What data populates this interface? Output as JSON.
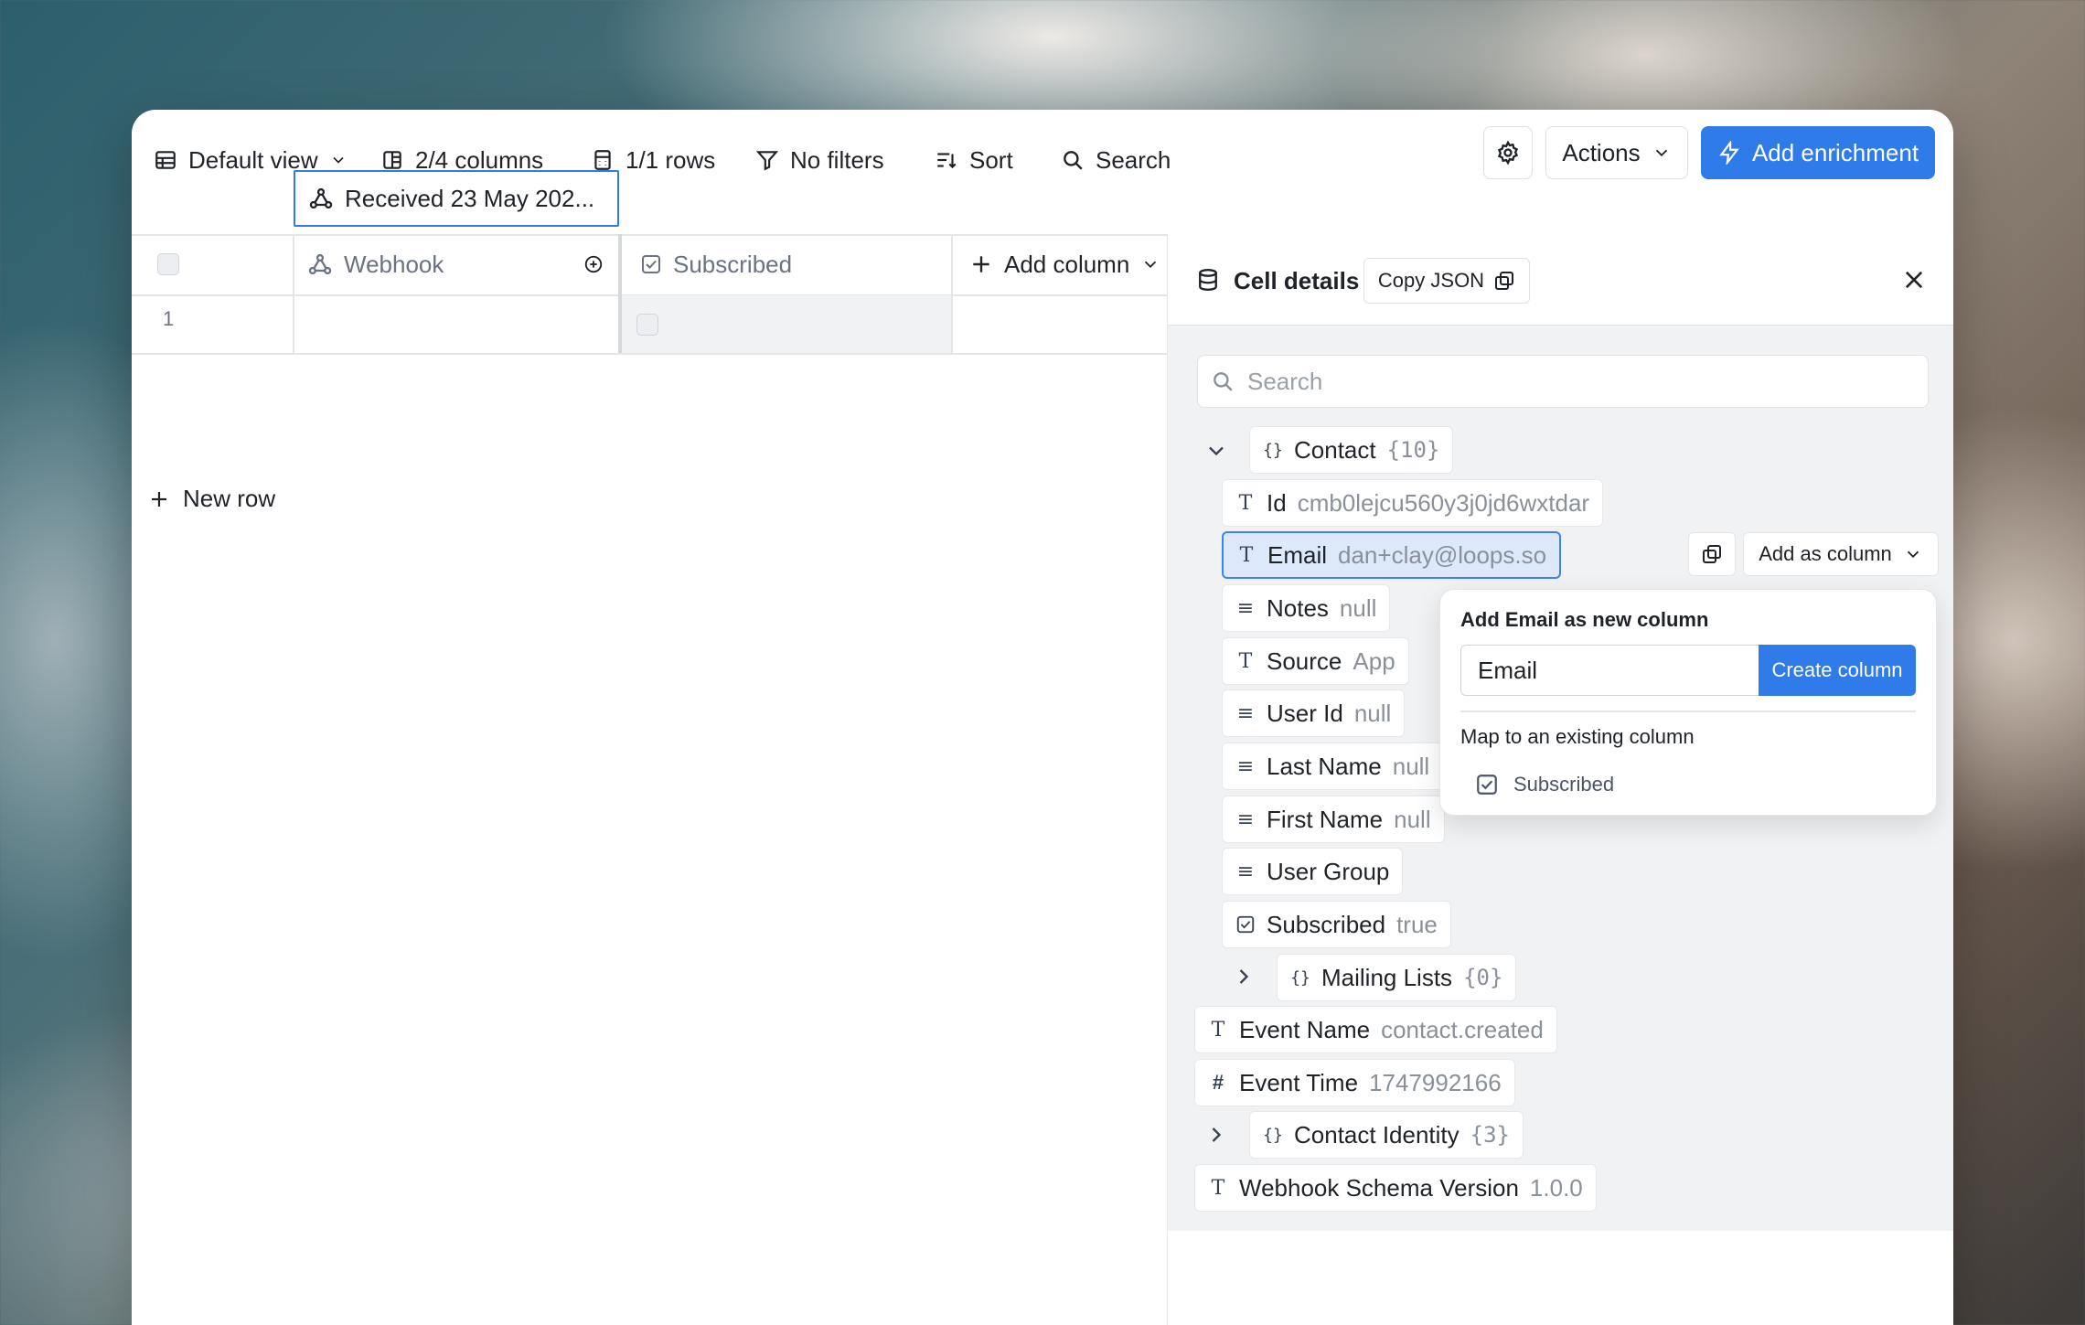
{
  "toolbar": {
    "view": "Default view",
    "columns": "2/4 columns",
    "rows": "1/1 rows",
    "filters": "No filters",
    "sort": "Sort",
    "search": "Search",
    "actions": "Actions",
    "add_enrichment": "Add enrichment"
  },
  "grid": {
    "headers": {
      "webhook": "Webhook",
      "subscribed": "Subscribed",
      "add_column": "Add column"
    },
    "rows": [
      {
        "num": "1",
        "webhook": "Received 23 May 202..."
      }
    ],
    "new_row": "New row"
  },
  "panel": {
    "title": "Cell details",
    "copy_json": "Copy JSON",
    "search_placeholder": "Search",
    "tree": {
      "contact": {
        "key": "Contact",
        "count": "{10}"
      },
      "id": {
        "key": "Id",
        "value": "cmb0lejcu560y3j0jd6wxtdar"
      },
      "email": {
        "key": "Email",
        "value": "dan+clay@loops.so"
      },
      "notes": {
        "key": "Notes",
        "value": "null"
      },
      "source": {
        "key": "Source",
        "value": "App"
      },
      "user_id": {
        "key": "User Id",
        "value": "null"
      },
      "last_name": {
        "key": "Last Name",
        "value": "null"
      },
      "first_name": {
        "key": "First Name",
        "value": "null"
      },
      "user_group": {
        "key": "User Group",
        "value": ""
      },
      "subscribed": {
        "key": "Subscribed",
        "value": "true"
      },
      "mailing_lists": {
        "key": "Mailing Lists",
        "count": "{0}"
      },
      "event_name": {
        "key": "Event Name",
        "value": "contact.created"
      },
      "event_time": {
        "key": "Event Time",
        "value": "1747992166"
      },
      "contact_identity": {
        "key": "Contact Identity",
        "count": "{3}"
      },
      "schema_version": {
        "key": "Webhook Schema Version",
        "value": "1.0.0"
      }
    },
    "add_as_column": "Add as column"
  },
  "popover": {
    "title": "Add Email as new column",
    "input_value": "Email",
    "create": "Create column",
    "map_label": "Map to an existing column",
    "options": [
      "Subscribed"
    ]
  },
  "colors": {
    "accent": "#2f7bea",
    "selected_bg": "#dde9fb"
  }
}
